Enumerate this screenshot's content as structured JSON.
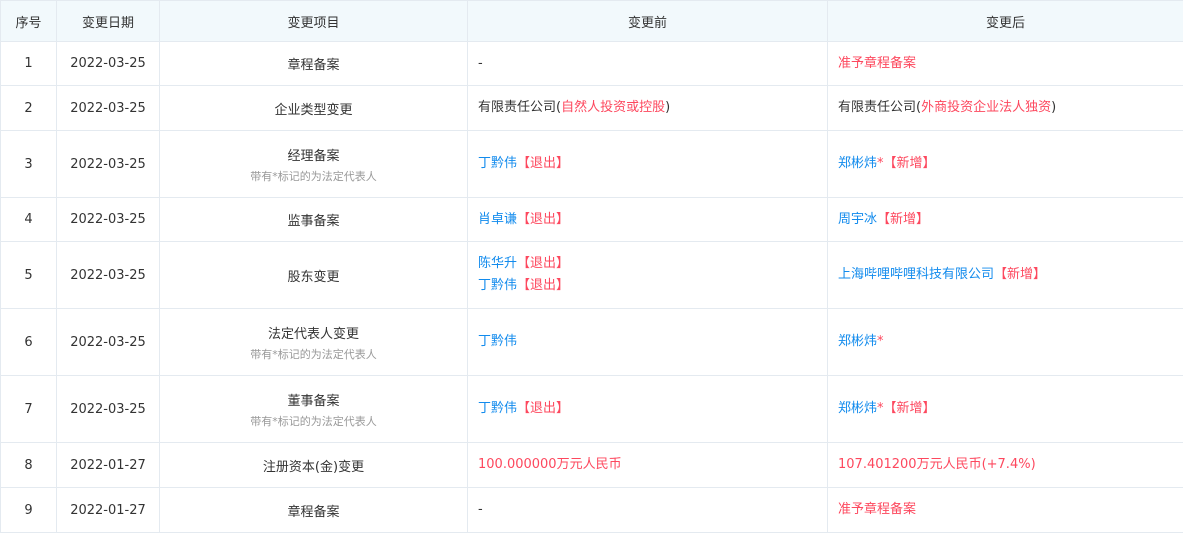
{
  "table": {
    "headers": [
      "序号",
      "变更日期",
      "变更项目",
      "变更前",
      "变更后"
    ],
    "rows": [
      {
        "idx": "1",
        "date": "2022-03-25",
        "item": "章程备案",
        "note": "",
        "before": [
          [
            {
              "t": "-",
              "c": "black"
            }
          ]
        ],
        "after": [
          [
            {
              "t": "准予章程备案",
              "c": "red"
            }
          ]
        ]
      },
      {
        "idx": "2",
        "date": "2022-03-25",
        "item": "企业类型变更",
        "note": "",
        "before": [
          [
            {
              "t": "有限责任公司(",
              "c": "black"
            },
            {
              "t": "自然人投资或控股",
              "c": "red"
            },
            {
              "t": ")",
              "c": "black"
            }
          ]
        ],
        "after": [
          [
            {
              "t": "有限责任公司(",
              "c": "black"
            },
            {
              "t": "外商投资企业法人独资",
              "c": "red"
            },
            {
              "t": ")",
              "c": "black"
            }
          ]
        ]
      },
      {
        "idx": "3",
        "date": "2022-03-25",
        "item": "经理备案",
        "note": "带有*标记的为法定代表人",
        "before": [
          [
            {
              "t": "丁黔伟",
              "c": "blue"
            },
            {
              "t": "【退出】",
              "c": "red"
            }
          ]
        ],
        "after": [
          [
            {
              "t": "郑彬炜",
              "c": "blue"
            },
            {
              "t": "*",
              "c": "red"
            },
            {
              "t": "【新增】",
              "c": "red"
            }
          ]
        ]
      },
      {
        "idx": "4",
        "date": "2022-03-25",
        "item": "监事备案",
        "note": "",
        "before": [
          [
            {
              "t": "肖卓谦",
              "c": "blue"
            },
            {
              "t": "【退出】",
              "c": "red"
            }
          ]
        ],
        "after": [
          [
            {
              "t": "周宇冰",
              "c": "blue"
            },
            {
              "t": "【新增】",
              "c": "red"
            }
          ]
        ]
      },
      {
        "idx": "5",
        "date": "2022-03-25",
        "item": "股东变更",
        "note": "",
        "before": [
          [
            {
              "t": "陈华升",
              "c": "blue"
            },
            {
              "t": "【退出】",
              "c": "red"
            }
          ],
          [
            {
              "t": "丁黔伟",
              "c": "blue"
            },
            {
              "t": "【退出】",
              "c": "red"
            }
          ]
        ],
        "after": [
          [
            {
              "t": "上海哔哩哔哩科技有限公司",
              "c": "blue"
            },
            {
              "t": "【新增】",
              "c": "red"
            }
          ]
        ]
      },
      {
        "idx": "6",
        "date": "2022-03-25",
        "item": "法定代表人变更",
        "note": "带有*标记的为法定代表人",
        "before": [
          [
            {
              "t": "丁黔伟",
              "c": "blue"
            }
          ]
        ],
        "after": [
          [
            {
              "t": "郑彬炜",
              "c": "blue"
            },
            {
              "t": "*",
              "c": "red"
            }
          ]
        ]
      },
      {
        "idx": "7",
        "date": "2022-03-25",
        "item": "董事备案",
        "note": "带有*标记的为法定代表人",
        "before": [
          [
            {
              "t": "丁黔伟",
              "c": "blue"
            },
            {
              "t": "【退出】",
              "c": "red"
            }
          ]
        ],
        "after": [
          [
            {
              "t": "郑彬炜",
              "c": "blue"
            },
            {
              "t": "*",
              "c": "red"
            },
            {
              "t": "【新增】",
              "c": "red"
            }
          ]
        ]
      },
      {
        "idx": "8",
        "date": "2022-01-27",
        "item": "注册资本(金)变更",
        "note": "",
        "before": [
          [
            {
              "t": "100.000000万元人民币",
              "c": "red"
            }
          ]
        ],
        "after": [
          [
            {
              "t": "107.401200万元人民币(+7.4%)",
              "c": "red"
            }
          ]
        ]
      },
      {
        "idx": "9",
        "date": "2022-01-27",
        "item": "章程备案",
        "note": "",
        "before": [
          [
            {
              "t": "-",
              "c": "black"
            }
          ]
        ],
        "after": [
          [
            {
              "t": "准予章程备案",
              "c": "red"
            }
          ]
        ]
      }
    ]
  },
  "colors": {
    "blue": "#128bed",
    "red": "#fd485e",
    "text": "#333333",
    "header_bg": "#f2f9fc",
    "border": "#e4eaf0"
  }
}
